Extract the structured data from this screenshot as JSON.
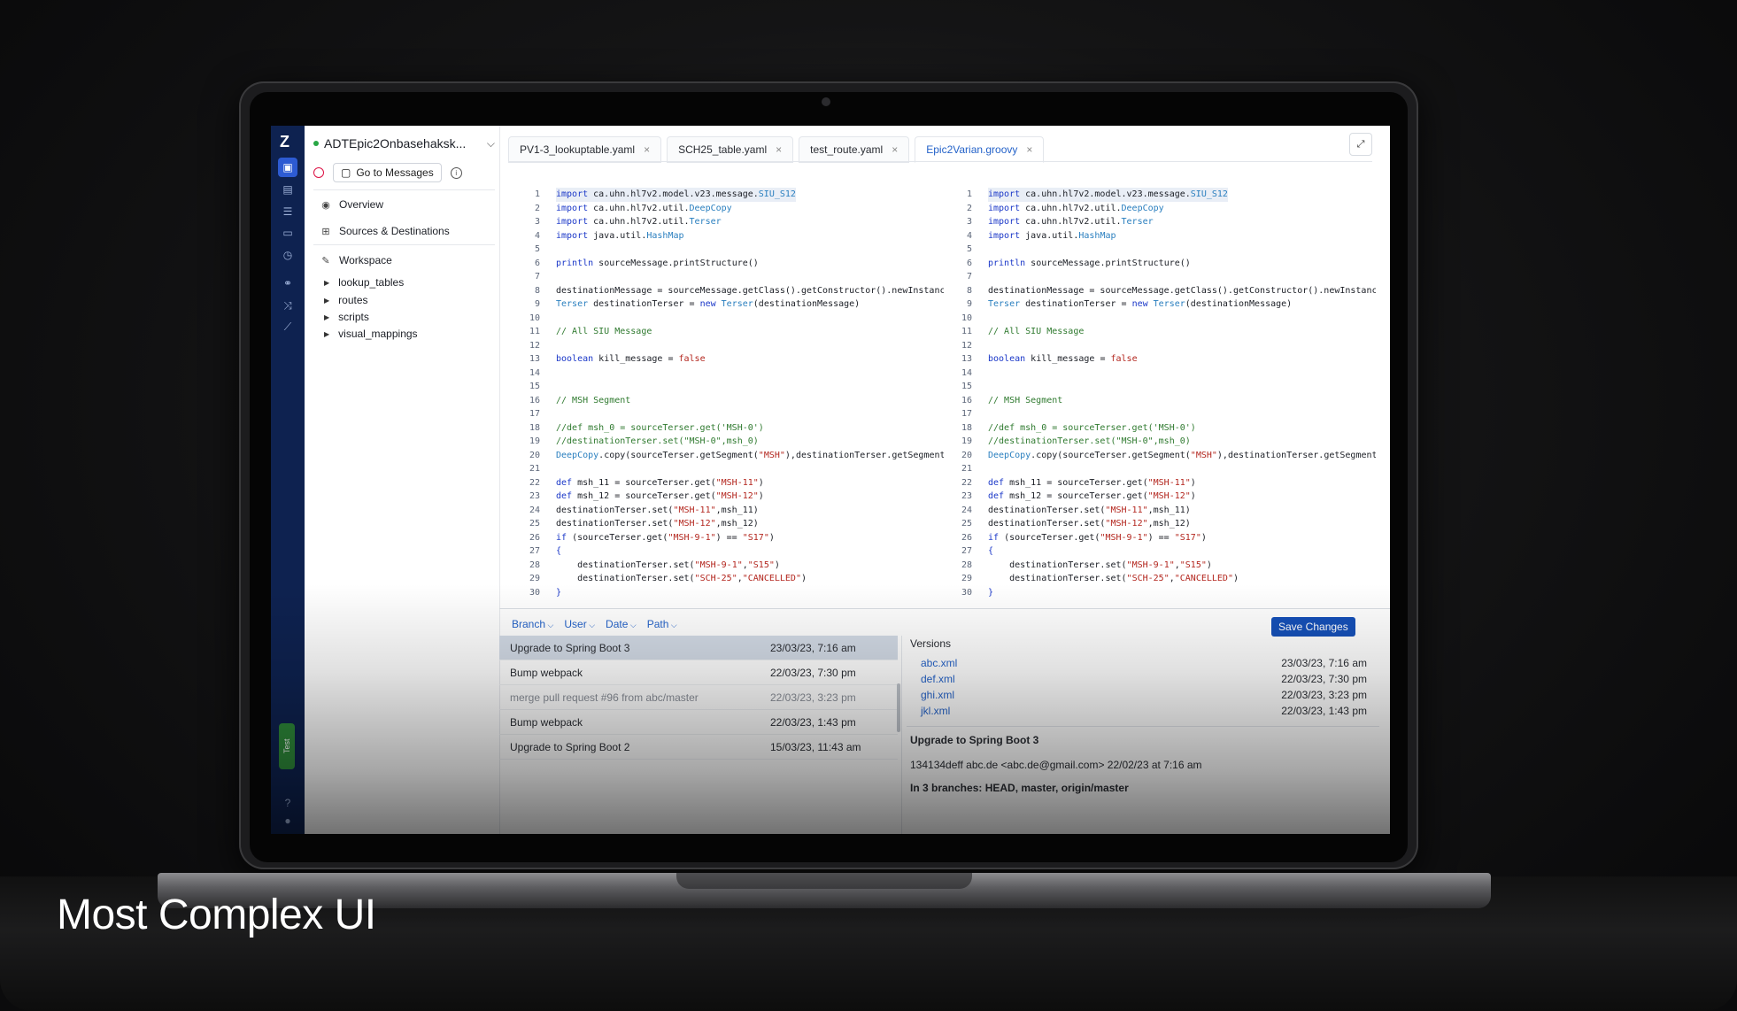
{
  "caption": "Most Complex UI",
  "project": {
    "name": "ADTEpic2Onbasehaksk...",
    "goto_label": "Go to Messages"
  },
  "nav": {
    "overview": "Overview",
    "sources": "Sources & Destinations",
    "workspace": "Workspace"
  },
  "tree": [
    "lookup_tables",
    "routes",
    "scripts",
    "visual_mappings"
  ],
  "rail": {
    "logo": "Z",
    "test_label": "Test"
  },
  "tabs": [
    {
      "label": "PV1-3_lookuptable.yaml"
    },
    {
      "label": "SCH25_table.yaml"
    },
    {
      "label": "test_route.yaml"
    },
    {
      "label": "Epic2Varian.groovy"
    }
  ],
  "code_lines": [
    [
      [
        "kw",
        "import"
      ],
      [
        "code",
        " ca.uhn.hl7v2.model.v23.message."
      ],
      [
        "ty",
        "SIU_S12"
      ]
    ],
    [
      [
        "kw",
        "import"
      ],
      [
        "code",
        " ca.uhn.hl7v2.util."
      ],
      [
        "ty",
        "DeepCopy"
      ]
    ],
    [
      [
        "kw",
        "import"
      ],
      [
        "code",
        " ca.uhn.hl7v2.util."
      ],
      [
        "ty",
        "Terser"
      ]
    ],
    [
      [
        "kw",
        "import"
      ],
      [
        "code",
        " java.util."
      ],
      [
        "ty",
        "HashMap"
      ]
    ],
    [],
    [
      [
        "kw",
        "println"
      ],
      [
        "code",
        " sourceMessage.printStructure()"
      ]
    ],
    [],
    [
      [
        "code",
        "destinationMessage = sourceMessage.getClass().getConstructor().newInstance()"
      ]
    ],
    [
      [
        "ty",
        "Terser"
      ],
      [
        "code",
        " destinationTerser = "
      ],
      [
        "kw",
        "new"
      ],
      [
        "code",
        " "
      ],
      [
        "ty",
        "Terser"
      ],
      [
        "code",
        "(destinationMessage)"
      ]
    ],
    [],
    [
      [
        "cm",
        "// All SIU Message"
      ]
    ],
    [],
    [
      [
        "kw",
        "boolean"
      ],
      [
        "code",
        " kill_message = "
      ],
      [
        "st",
        "false"
      ]
    ],
    [],
    [],
    [
      [
        "cm",
        "// MSH Segment"
      ]
    ],
    [],
    [
      [
        "cm",
        "//def msh_0 = sourceTerser.get('MSH-0')"
      ]
    ],
    [
      [
        "cm",
        "//destinationTerser.set(\"MSH-0\",msh_0)"
      ]
    ],
    [
      [
        "ty",
        "DeepCopy"
      ],
      [
        "code",
        ".copy(sourceTerser.getSegment("
      ],
      [
        "st",
        "\"MSH\""
      ],
      [
        "code",
        "),destinationTerser.getSegment(\"MSH\"))"
      ]
    ],
    [],
    [
      [
        "kw",
        "def"
      ],
      [
        "code",
        " msh_11 = sourceTerser.get("
      ],
      [
        "st",
        "\"MSH-11\""
      ],
      [
        "code",
        ")"
      ]
    ],
    [
      [
        "kw",
        "def"
      ],
      [
        "code",
        " msh_12 = sourceTerser.get("
      ],
      [
        "st",
        "\"MSH-12\""
      ],
      [
        "code",
        ")"
      ]
    ],
    [
      [
        "code",
        "destinationTerser.set("
      ],
      [
        "st",
        "\"MSH-11\""
      ],
      [
        "code",
        ",msh_11)"
      ]
    ],
    [
      [
        "code",
        "destinationTerser.set("
      ],
      [
        "st",
        "\"MSH-12\""
      ],
      [
        "code",
        ",msh_12)"
      ]
    ],
    [
      [
        "kw",
        "if"
      ],
      [
        "code",
        " (sourceTerser.get("
      ],
      [
        "st",
        "\"MSH-9-1\""
      ],
      [
        "code",
        ") == "
      ],
      [
        "st",
        "\"S17\""
      ],
      [
        "code",
        ")"
      ]
    ],
    [
      [
        "kw",
        "{"
      ]
    ],
    [
      [
        "code",
        "    destinationTerser.set("
      ],
      [
        "st",
        "\"MSH-9-1\""
      ],
      [
        "code",
        ","
      ],
      [
        "st",
        "\"S15\""
      ],
      [
        "code",
        ")"
      ]
    ],
    [
      [
        "code",
        "    destinationTerser.set("
      ],
      [
        "st",
        "\"SCH-25\""
      ],
      [
        "code",
        ","
      ],
      [
        "st",
        "\"CANCELLED\""
      ],
      [
        "code",
        ")"
      ]
    ],
    [
      [
        "kw",
        "}"
      ]
    ]
  ],
  "history": {
    "filters": [
      "Branch",
      "User",
      "Date",
      "Path"
    ],
    "save_label": "Save Changes",
    "commits": [
      {
        "msg": "Upgrade to Spring Boot 3",
        "date": "23/03/23, 7:16 am"
      },
      {
        "msg": "Bump webpack",
        "date": "22/03/23, 7:30 pm"
      },
      {
        "msg": "merge pull request #96 from  abc/master",
        "date": "22/03/23, 3:23 pm"
      },
      {
        "msg": "Bump webpack",
        "date": "22/03/23, 1:43 pm"
      },
      {
        "msg": "Upgrade to Spring Boot 2",
        "date": "15/03/23, 11:43 am"
      }
    ],
    "versions_title": "Versions",
    "versions": [
      {
        "file": "abc.xml",
        "date": "23/03/23, 7:16 am"
      },
      {
        "file": "def.xml",
        "date": "22/03/23, 7:30 pm"
      },
      {
        "file": "ghi.xml",
        "date": "22/03/23, 3:23 pm"
      },
      {
        "file": "jkl.xml",
        "date": "22/03/23, 1:43 pm"
      }
    ],
    "detail_title": "Upgrade to Spring Boot 3",
    "detail_meta": "134134deff abc.de <abc.de@gmail.com> 22/02/23 at 7:16 am",
    "detail_branches": "In 3 branches: HEAD, master, origin/master"
  }
}
